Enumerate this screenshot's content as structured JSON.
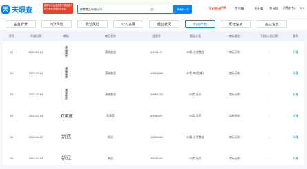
{
  "header": {
    "logo_mark": "天",
    "logo_text": "天眼查",
    "promo_lines": [
      "国家中小企业发展子基金旗下",
      "官方备案企业征信机构"
    ],
    "search_value": "仲景食品有限公司",
    "search_button": "天眼一下",
    "vip_label": "VIP会员",
    "vip_badge": "优惠",
    "nav": [
      "百宝箱",
      "企业版",
      "专业版",
      "消费者中心",
      "TYC"
    ]
  },
  "tabs": [
    {
      "label": "企业背景",
      "badge": "",
      "active": false
    },
    {
      "label": "司法风险",
      "badge": "",
      "active": false
    },
    {
      "label": "经营风险",
      "badge": "",
      "active": false
    },
    {
      "label": "公司发展",
      "badge": "",
      "active": false
    },
    {
      "label": "经营状况",
      "badge": "",
      "active": false
    },
    {
      "label": "知识产权",
      "badge": "",
      "active": true
    },
    {
      "label": "历史信息",
      "badge": "",
      "active": false
    },
    {
      "label": "自主信息",
      "badge": "",
      "active": false
    }
  ],
  "table": {
    "columns": [
      "序号",
      "申请日期",
      "商标",
      "商标名称",
      "注册号",
      "国际分类",
      "商标状态",
      "注册公告日期",
      "操作"
    ],
    "rows": [
      {
        "no": "91",
        "date": "2020-02-04",
        "mark": "满福美居",
        "name": "满福美居",
        "reg": "43994167",
        "class": "30类-方便食品",
        "status": "商标无效",
        "notice": "-",
        "op": "详情"
      },
      {
        "no": "92",
        "date": "2020-02-04",
        "mark": "满福美居",
        "name": "满福美居",
        "reg": "43993086",
        "class": "30类-啤酒饮料",
        "status": "商标无效",
        "notice": "-",
        "op": "详情"
      },
      {
        "no": "93",
        "date": "2020-02-04",
        "mark": "满福美居",
        "name": "满福美居",
        "reg": "43995753",
        "class": "05类-医药",
        "status": "商标无效",
        "notice": "-",
        "op": "详情"
      },
      {
        "no": "94",
        "date": "2020-02-03",
        "mark": "双黄莲",
        "name": "双黄莲",
        "reg": "43986397",
        "class": "05类-医药",
        "status": "商标无效",
        "notice": "-",
        "op": "详情"
      },
      {
        "no": "95",
        "date": "2020-02-03",
        "mark": "新冠",
        "name": "新冠",
        "reg": "43960364",
        "class": "30类-方便食品",
        "status": "商标无效",
        "notice": "-",
        "op": "详情"
      },
      {
        "no": "96",
        "date": "2020-02-03",
        "mark": "新冠",
        "name": "新冠",
        "reg": "43961160",
        "class": "05类-医药",
        "status": "商标无效",
        "notice": "-",
        "op": "详情"
      }
    ]
  }
}
